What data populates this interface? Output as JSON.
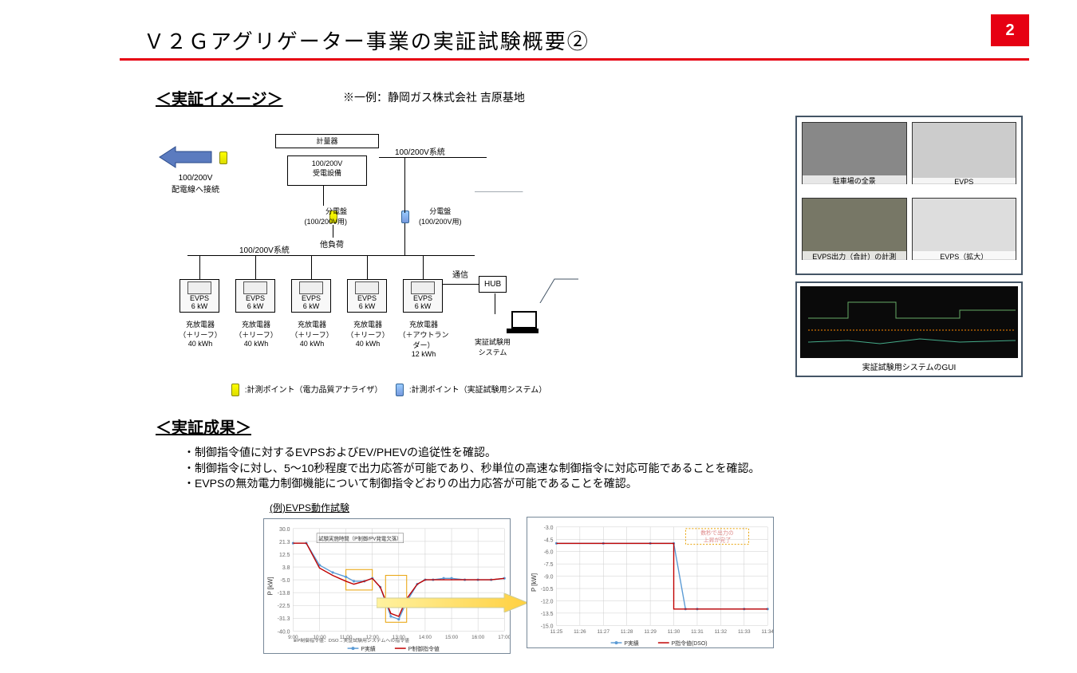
{
  "page_number": "2",
  "title": "Ｖ２Ｇアグリゲーター事業の実証試験概要②",
  "section1": {
    "heading": "＜実証イメージ＞",
    "note": "※一例：静岡ガス株式会社 吉原基地"
  },
  "diagram": {
    "grid_label": "100/200V\n配電線へ接続",
    "meter_box": "計量器",
    "recv_box": "100/200V\n受電設備",
    "line1": "100/200V系統",
    "dist1_label": "分電盤\n(100/200V用)",
    "other_load": "他負荷",
    "dist2_label": "分電盤\n(100/200V用)",
    "line2": "100/200V系統",
    "comm": "通信",
    "hub": "HUB",
    "system_label": "実証試験用\nシステム",
    "evps_top": "EVPS",
    "evps_power": "6 kW",
    "chargers": [
      {
        "name": "充放電器",
        "veh": "（＋リーフ）",
        "cap": "40 kWh"
      },
      {
        "name": "充放電器",
        "veh": "（＋リーフ）",
        "cap": "40 kWh"
      },
      {
        "name": "充放電器",
        "veh": "（＋リーフ）",
        "cap": "40 kWh"
      },
      {
        "name": "充放電器",
        "veh": "（＋リーフ）",
        "cap": "40 kWh"
      },
      {
        "name": "充放電器",
        "veh": "（＋アウトランダー）",
        "cap": "12 kWh"
      }
    ]
  },
  "legend": {
    "yellow": ":計測ポイント（電力品質アナライザ）",
    "blue": ":計測ポイント（実証試験用システム）"
  },
  "photos": {
    "p1": "駐車場の全景",
    "p2": "EVPS",
    "p3": "EVPS出力（合計）の計測",
    "p4": "EVPS（拡大）"
  },
  "gui_caption": "実証試験用システムのGUI",
  "section2": {
    "heading": "＜実証成果＞",
    "bullets": [
      "・制御指令値に対するEVPSおよびEV/PHEVの追従性を確認。",
      "・制御指令に対し、5～10秒程度で出力応答が可能であり、秒単位の高速な制御指令に対応可能であることを確認。",
      "・EVPSの無効電力制御機能について制御指令どおりの出力応答が可能であることを確認。"
    ],
    "example": "(例)EVPS動作試験",
    "footnote": "※P制御指令値：DSO→実証試験用システムへの指令値"
  },
  "chart_data": [
    {
      "type": "line",
      "title": "",
      "xlabel": "",
      "ylabel": "P [kW]",
      "ylim": [
        -40,
        30
      ],
      "xticks": [
        "9:00",
        "10:00",
        "11:00",
        "12:00",
        "13:00",
        "14:00",
        "15:00",
        "16:00",
        "17:00"
      ],
      "annotation": "試験実施時間（P制御/PV発電欠落）",
      "legend": [
        "P実績",
        "P制御指令値"
      ],
      "series": [
        {
          "name": "P実績",
          "color": "#5b9bd5",
          "x": [
            9,
            9.5,
            10,
            10.5,
            11,
            11.3,
            11.7,
            12,
            12.3,
            12.7,
            13,
            13.3,
            13.7,
            14,
            14.3,
            14.7,
            15,
            15.5,
            16,
            16.5,
            17
          ],
          "y": [
            20,
            20,
            5,
            0,
            -3,
            -6,
            -6,
            -4,
            -10,
            -30,
            -32,
            -20,
            -8,
            -5,
            -5,
            -4,
            -4,
            -5,
            -5,
            -5,
            -4
          ]
        },
        {
          "name": "P制御指令値",
          "color": "#c00000",
          "x": [
            9,
            9.5,
            10,
            10.5,
            11,
            11.3,
            11.7,
            12,
            12.3,
            12.7,
            13,
            13.3,
            13.7,
            14,
            14.3,
            14.7,
            15,
            15.5,
            16,
            16.5,
            17
          ],
          "y": [
            20,
            20,
            3,
            -2,
            -6,
            -8,
            -6,
            -4,
            -10,
            -28,
            -30,
            -18,
            -8,
            -5,
            -5,
            -5,
            -5,
            -5,
            -5,
            -5,
            -4
          ]
        }
      ],
      "highlight_boxes": [
        [
          11,
          -12,
          12,
          2
        ],
        [
          12.5,
          -34,
          13.3,
          -2
        ]
      ]
    },
    {
      "type": "line",
      "title": "",
      "xlabel": "",
      "ylabel": "P [kW]",
      "ylim": [
        -15,
        -3
      ],
      "xticks": [
        "11:25",
        "11:26",
        "11:27",
        "11:28",
        "11:29",
        "11:30",
        "11:31",
        "11:32",
        "11:33",
        "11:34"
      ],
      "annotation": "数秒で出力の\n上昇が完了",
      "legend": [
        "P実績",
        "P指令値(DSO)"
      ],
      "series": [
        {
          "name": "P実績",
          "color": "#5b9bd5",
          "x": [
            11.25,
            11.27,
            11.29,
            11.3,
            11.305,
            11.31,
            11.33,
            11.34
          ],
          "y": [
            -5,
            -5,
            -5,
            -5,
            -13,
            -13,
            -13,
            -13
          ]
        },
        {
          "name": "P指令値(DSO)",
          "color": "#c00000",
          "x": [
            11.25,
            11.27,
            11.29,
            11.3,
            11.3,
            11.31,
            11.33,
            11.34
          ],
          "y": [
            -5,
            -5,
            -5,
            -5,
            -13,
            -13,
            -13,
            -13
          ]
        }
      ]
    }
  ]
}
